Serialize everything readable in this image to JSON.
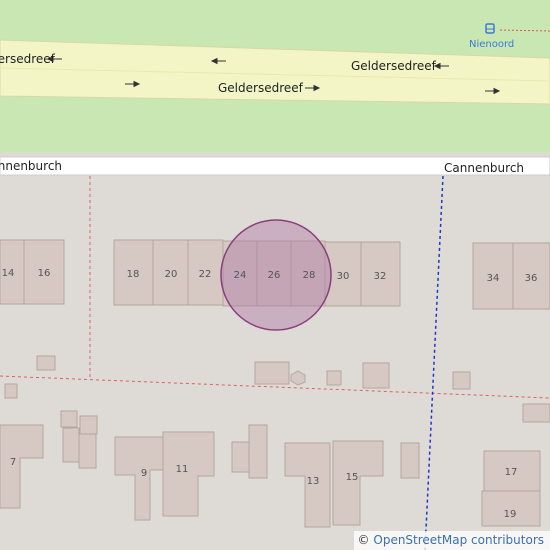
{
  "map": {
    "streets": {
      "main_a": "Geldersedreef",
      "main_b": "Geldersedreef",
      "main_c": "Geldersedreef",
      "side_left": "Cannenburch",
      "side_right": "Cannenburch"
    },
    "bus_stop": {
      "name": "Nienoord",
      "icon": "bus-icon"
    },
    "house_numbers": {
      "h14": "14",
      "h16": "16",
      "h18": "18",
      "h20": "20",
      "h22": "22",
      "h24": "24",
      "h26": "26",
      "h28": "28",
      "h30": "30",
      "h32": "32",
      "h34": "34",
      "h36": "36",
      "h7": "7",
      "h9": "9",
      "h11": "11",
      "h13": "13",
      "h15": "15",
      "h17": "17",
      "h19": "19"
    },
    "arrow_glyph": "⟶",
    "colors": {
      "grass": "#c8e6b0",
      "road": "#f5f5c0",
      "road_edge": "#d9d9a0",
      "building": "#d5c7c0",
      "building_edge": "#b8a8a0",
      "highlight_fill": "#b07aa6",
      "highlight_stroke": "#8a3f7d",
      "boundary_red": "#e06060",
      "boundary_blue": "#2233cc",
      "bus_blue": "#3a7ad6"
    }
  },
  "attribution": {
    "symbol": "©",
    "text": "OpenStreetMap contributors"
  }
}
